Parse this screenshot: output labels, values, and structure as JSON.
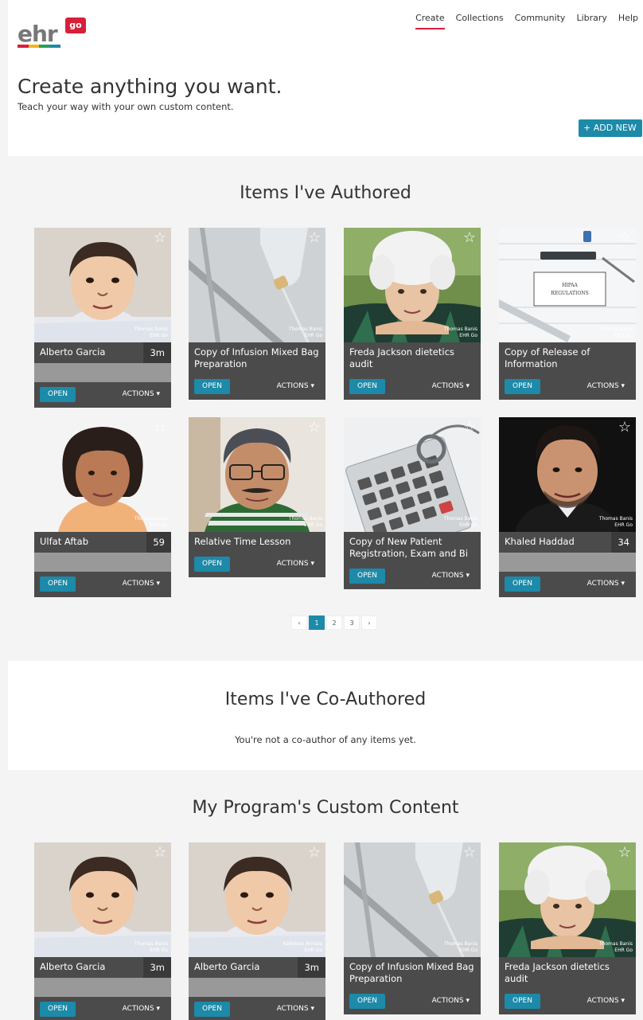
{
  "logo": {
    "text": "ehr",
    "badge": "go",
    "bar_colors": [
      "#d81f3a",
      "#f3b51b",
      "#2a9d5b",
      "#1c8aa8"
    ]
  },
  "nav": {
    "items": [
      "Create",
      "Collections",
      "Community",
      "Library",
      "Help"
    ],
    "active": "Create"
  },
  "hero": {
    "title": "Create anything you want.",
    "subtitle": "Teach your way with your own custom content.",
    "add_button": "+ ADD NEW"
  },
  "sections": {
    "authored": "Items I've Authored",
    "coauthored": "Items I've Co-Authored",
    "coauthored_empty": "You're not a co-author of any items yet.",
    "program": "My Program's Custom Content"
  },
  "buttons": {
    "open": "OPEN",
    "actions": "ACTIONS ▾"
  },
  "pagination": [
    "‹",
    "1",
    "2",
    "3",
    "›"
  ],
  "colors": {
    "accent": "#1c8aa8",
    "brand_red": "#d81f3a",
    "card_dark": "#4b4b4b"
  },
  "authored_cards": [
    {
      "title": "Alberto Garcia",
      "count": "3m",
      "image": "baby",
      "credit": "Thomas Banis\nEHR Go"
    },
    {
      "title": "Copy of Infusion Mixed Bag Preparation",
      "count": "",
      "image": "iv-bag",
      "credit": "Thomas Banis\nEHR Go"
    },
    {
      "title": "Freda Jackson dietetics audit",
      "count": "",
      "image": "elderly-woman",
      "credit": "Thomas Banis\nEHR Go"
    },
    {
      "title": "Copy of Release of Information",
      "count": "",
      "image": "hipaa",
      "credit": "Thomas Banis\nEHR Go"
    },
    {
      "title": "Ulfat Aftab",
      "count": "59",
      "image": "woman",
      "credit": "Thomas Banis\nEHR Go"
    },
    {
      "title": "Relative Time Lesson",
      "count": "",
      "image": "man-glasses",
      "credit": "Thomas Banis\nEHR Go"
    },
    {
      "title": "Copy of New Patient Registration, Exam and Bi",
      "count": "",
      "image": "calculator",
      "credit": "Thomas Banis\nEHR Go"
    },
    {
      "title": "Khaled Haddad",
      "count": "34",
      "image": "young-man",
      "credit": "Thomas Banis\nEHR Go"
    }
  ],
  "program_cards": [
    {
      "title": "Alberto Garcia",
      "count": "3m",
      "image": "baby",
      "credit": "Thomas Banis\nEHR Go"
    },
    {
      "title": "Alberto Garcia",
      "count": "3m",
      "image": "baby",
      "credit": "Kathleen Annala\nEHR Go"
    },
    {
      "title": "Copy of Infusion Mixed Bag Preparation",
      "count": "",
      "image": "iv-bag",
      "credit": "Thomas Banis\nEHR Go"
    },
    {
      "title": "Freda Jackson dietetics audit",
      "count": "",
      "image": "elderly-woman",
      "credit": "Thomas Banis\nEHR Go"
    }
  ],
  "star_icon": "star-outline-icon",
  "hipaa_text": "HIPAA\nREGULATIONS"
}
